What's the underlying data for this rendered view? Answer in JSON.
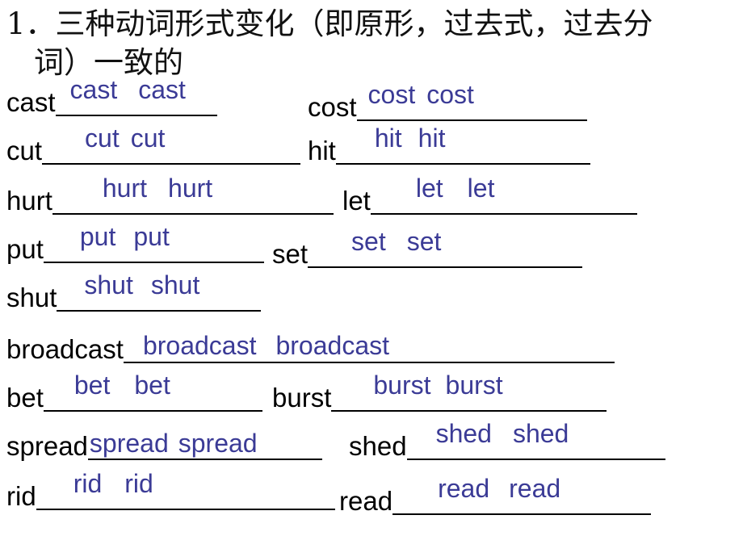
{
  "slide": {
    "title_lines": [
      "1．三种动词形式变化（即原形，过去式，过去分",
      "词）一致的"
    ],
    "answer_color": "#3b3b96",
    "text_color": "#000000",
    "rule_color": "#000000",
    "rows": [
      {
        "left": {
          "prompt": "cast",
          "answers": [
            "cast",
            "cast"
          ]
        },
        "right": {
          "prompt": "cost",
          "answers": [
            "cost",
            "cost"
          ]
        }
      },
      {
        "left": {
          "prompt": "cut",
          "answers": [
            "cut",
            "cut"
          ]
        },
        "right": {
          "prompt": "hit",
          "answers": [
            "hit",
            "hit"
          ]
        }
      },
      {
        "left": {
          "prompt": "hurt",
          "answers": [
            "hurt",
            "hurt"
          ]
        },
        "right": {
          "prompt": "let",
          "answers": [
            "let",
            "let"
          ]
        }
      },
      {
        "left": {
          "prompt": "put",
          "answers": [
            "put",
            "put"
          ]
        },
        "right": {
          "prompt": "set",
          "answers": [
            "set",
            "set"
          ]
        }
      },
      {
        "left": {
          "prompt": "shut",
          "answers": [
            "shut",
            "shut"
          ]
        },
        "right": null
      },
      {
        "left": {
          "prompt": "broadcast",
          "answers": [
            "broadcast",
            "broadcast"
          ]
        },
        "right": null
      },
      {
        "left": {
          "prompt": "bet",
          "answers": [
            "bet",
            "bet"
          ]
        },
        "right": {
          "prompt": "burst",
          "answers": [
            "burst",
            "burst"
          ]
        }
      },
      {
        "left": {
          "prompt": "spread",
          "answers": [
            "spread",
            "spread"
          ]
        },
        "right": {
          "prompt": "shed",
          "answers": [
            "shed",
            "shed"
          ]
        }
      },
      {
        "left": {
          "prompt": "rid",
          "answers": [
            "rid",
            "rid"
          ]
        },
        "right": {
          "prompt": "read",
          "answers": [
            "read",
            "read"
          ]
        }
      }
    ]
  }
}
